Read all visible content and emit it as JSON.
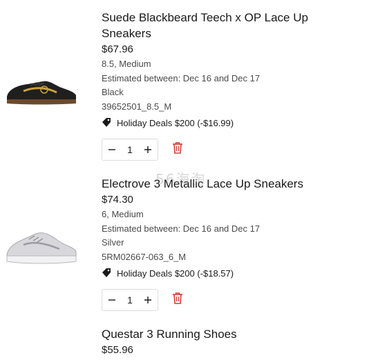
{
  "colors": {
    "delete": "#d63a3a",
    "text": "#191919",
    "muted": "#4a4a4a"
  },
  "items": [
    {
      "name": "Suede Blackbeard Teech x OP Lace Up Sneakers",
      "price": "$67.96",
      "size": "8.5, Medium",
      "estimate": "Estimated between: Dec 16 and Dec 17",
      "color": "Black",
      "sku": "39652501_8.5_M",
      "promo": "Holiday Deals $200 (-$16.99)",
      "quantity": "1"
    },
    {
      "name": "Electrove 3 Metallic Lace Up Sneakers",
      "price": "$74.30",
      "size": "6, Medium",
      "estimate": "Estimated between: Dec 16 and Dec 17",
      "color": "Silver",
      "sku": "5RM02667-063_6_M",
      "promo": "Holiday Deals $200 (-$18.57)",
      "quantity": "1"
    },
    {
      "name": "Questar 3 Running Shoes",
      "price": "$55.96"
    }
  ],
  "watermark": "56海淘"
}
